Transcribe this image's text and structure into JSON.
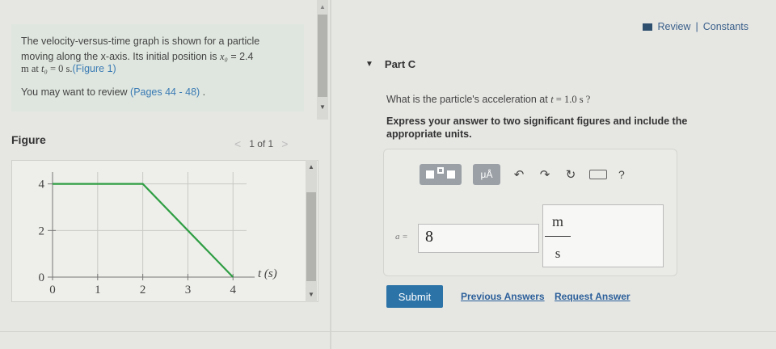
{
  "intro": {
    "line1": "The velocity-versus-time graph is shown for a particle",
    "line2_a": "moving along the x-axis. Its initial position is ",
    "line2_math": "x₀",
    "line2_b": " = 2.4",
    "line3_a": "m at ",
    "line3_math": "t₀",
    "line3_b": " = 0 s.",
    "figure_link": "(Figure 1)",
    "review_text": "You may want to review ",
    "review_link": "(Pages 44 - 48)",
    "review_end": " ."
  },
  "figure": {
    "title": "Figure",
    "pager_text": "1 of 1",
    "prev": "<",
    "next": ">"
  },
  "chart_data": {
    "type": "line",
    "x": [
      0,
      2,
      4
    ],
    "y": [
      4,
      4,
      0
    ],
    "xticks": [
      "0",
      "1",
      "2",
      "3",
      "4"
    ],
    "yticks": [
      "0",
      "2",
      "4"
    ],
    "xlabel": "t (s)",
    "ylabel": "",
    "xlim": [
      0,
      4.3
    ],
    "ylim": [
      0,
      4.3
    ],
    "grid": true,
    "line_color": "#2e9e43"
  },
  "header": {
    "review_link": "Review",
    "separator": "|",
    "constants_link": "Constants"
  },
  "part": {
    "toggle": "▼",
    "title": "Part C"
  },
  "question": {
    "text_a": "What is the particle's acceleration at ",
    "math_t": "t",
    "text_b": " = 1.0 s ?",
    "instruction": "Express your answer to two significant figures and include the appropriate units."
  },
  "toolbar": {
    "units_label": "μÅ",
    "undo": "↶",
    "redo": "↷",
    "reset": "↻",
    "help": "?"
  },
  "answer": {
    "label": "a =",
    "value": "8",
    "unit_numerator": "m",
    "unit_denominator": "s"
  },
  "actions": {
    "submit": "Submit",
    "previous_answers": "Previous Answers",
    "request_answer": "Request Answer"
  }
}
